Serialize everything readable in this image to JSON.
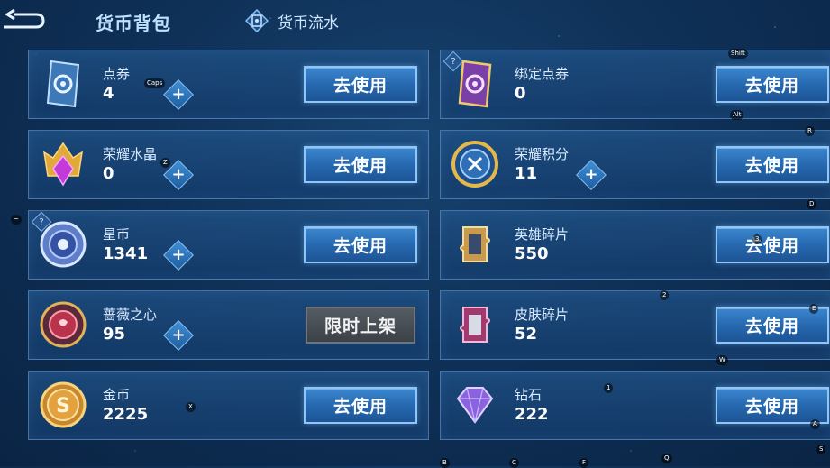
{
  "header": {
    "title": "货币背包",
    "tab_flow": "货币流水"
  },
  "cards": [
    {
      "name": "点券",
      "value": "4",
      "action": "去使用",
      "plus": "+",
      "help": "?"
    },
    {
      "name": "绑定点券",
      "value": "0",
      "action": "去使用",
      "help": "?"
    },
    {
      "name": "荣耀水晶",
      "value": "0",
      "action": "去使用",
      "plus": "+"
    },
    {
      "name": "荣耀积分",
      "value": "11",
      "action": "去使用",
      "plus": "+"
    },
    {
      "name": "星币",
      "value": "1341",
      "action": "去使用",
      "plus": "+",
      "help": "?"
    },
    {
      "name": "英雄碎片",
      "value": "550",
      "action": "去使用"
    },
    {
      "name": "蔷薇之心",
      "value": "95",
      "action": "限时上架",
      "plus": "+"
    },
    {
      "name": "皮肤碎片",
      "value": "52",
      "action": "去使用"
    },
    {
      "name": "金币",
      "value": "2225",
      "action": "去使用"
    },
    {
      "name": "钻石",
      "value": "222",
      "action": "去使用"
    }
  ],
  "key_hints": [
    "Shift",
    "Caps",
    "Alt",
    "R",
    "Z",
    "D",
    "~",
    "3",
    "2",
    "E",
    "W",
    "X",
    "1",
    "A",
    "S",
    "B",
    "C",
    "F",
    "Q"
  ],
  "colors": {
    "accent": "#2566ad",
    "card_border": "#6ea0d7",
    "disabled": "#4a5157"
  },
  "icons": [
    "back-arrow-icon",
    "flow-card-icon",
    "ticket-card-icon",
    "bound-ticket-icon",
    "crystal-icon",
    "honor-points-icon",
    "star-coin-icon",
    "hero-fragment-icon",
    "rose-heart-icon",
    "skin-fragment-icon",
    "gold-coin-icon",
    "diamond-icon"
  ]
}
